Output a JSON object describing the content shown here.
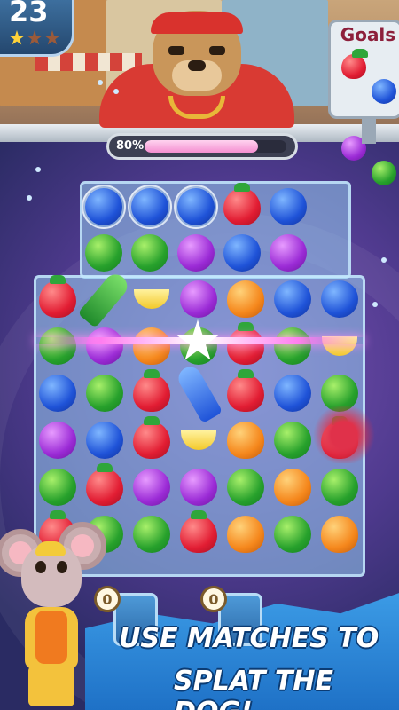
{
  "level": {
    "number": "23",
    "stars_earned": 1,
    "stars_total": 3
  },
  "goals": {
    "title": "Goals",
    "items": [
      "strawberry",
      "blueberry",
      "grape",
      "apple"
    ]
  },
  "progress": {
    "label": "80%",
    "value": 0.8
  },
  "board": {
    "top_rows": [
      [
        "bubble-blueberry",
        "bubble-blueberry",
        "bubble-blueberry",
        "strawberry",
        "blueberry"
      ],
      [
        "apple",
        "apple",
        "grape",
        "blueberry",
        "grape"
      ]
    ],
    "rows": [
      [
        "strawberry",
        "rocket-green",
        "banana",
        "grape",
        "orange",
        "blueberry",
        "blueberry"
      ],
      [
        "apple",
        "grape",
        "orange",
        "apple",
        "strawberry",
        "apple",
        "banana"
      ],
      [
        "blueberry",
        "apple",
        "strawberry",
        "rocket-blue",
        "strawberry",
        "blueberry",
        "apple"
      ],
      [
        "grape",
        "blueberry",
        "strawberry",
        "banana",
        "orange",
        "apple",
        "strawberry"
      ],
      [
        "apple",
        "strawberry",
        "grape",
        "grape",
        "apple",
        "orange",
        "apple"
      ],
      [
        "strawberry",
        "apple",
        "apple",
        "strawberry",
        "orange",
        "apple",
        "orange"
      ]
    ]
  },
  "boosters": [
    {
      "count": "0",
      "icon": "hammer-icon"
    },
    {
      "count": "0",
      "icon": "rocket-icon"
    }
  ],
  "caption": {
    "line1": "USE MATCHES TO",
    "line2": "SPLAT THE DOG!"
  },
  "colors": {
    "progress_fill": "#f48fd1",
    "level_badge": "#2e5a87",
    "wave": "#1d6fc5"
  }
}
